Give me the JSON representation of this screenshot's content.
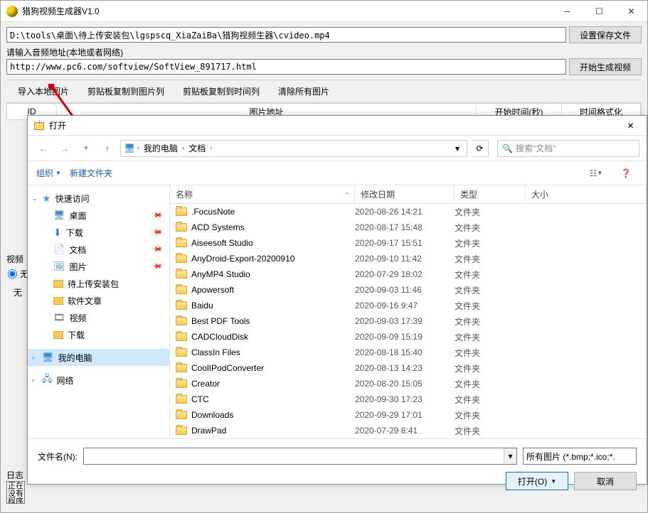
{
  "main": {
    "title": "猎狗视频生成器V1.0",
    "path_input": "D:\\tools\\桌面\\待上传安装包\\lgspscq_XiaZaiBa\\猎狗视频生器\\cvideo.mp4",
    "audio_label": "请输入音频地址(本地或者网络)",
    "audio_input": "http://www.pc6.com/softview/SoftView_891717.html",
    "btn_save": "设置保存文件",
    "btn_start": "开始生成视频",
    "toolbar": {
      "import": "导入本地图片",
      "copy_pic": "剪贴板复制到图片列",
      "copy_time": "剪贴板复制到时间列",
      "clear": "清除所有图片"
    },
    "grid": {
      "id": "ID",
      "addr": "图片地址",
      "start": "开始时间(秒)",
      "time": "时间格式化"
    },
    "side": {
      "video": "视频",
      "none_radio": "无",
      "none": "无"
    },
    "log": {
      "label": "日志",
      "text": "正在\n没有\n程序"
    }
  },
  "dialog": {
    "title": "打开",
    "breadcrumb": {
      "pc": "我的电脑",
      "docs": "文档"
    },
    "search_placeholder": "搜索\"文档\"",
    "organize": "组织",
    "newfolder": "新建文件夹",
    "headers": {
      "name": "名称",
      "date": "修改日期",
      "type": "类型",
      "size": "大小"
    },
    "tree": {
      "quick": "快速访问",
      "desktop": "桌面",
      "downloads": "下载",
      "documents": "文档",
      "pictures": "图片",
      "upload_pkg": "待上传安装包",
      "soft_article": "软件文章",
      "video": "视频",
      "downloads2": "下载",
      "this_pc": "我的电脑",
      "network": "网络"
    },
    "files": [
      {
        "name": ".FocusNote",
        "date": "2020-08-26 14:21",
        "type": "文件夹"
      },
      {
        "name": "ACD Systems",
        "date": "2020-08-17 15:48",
        "type": "文件夹"
      },
      {
        "name": "Aiseesoft Studio",
        "date": "2020-09-17 15:51",
        "type": "文件夹"
      },
      {
        "name": "AnyDroid-Export-20200910",
        "date": "2020-09-10 11:42",
        "type": "文件夹"
      },
      {
        "name": "AnyMP4 Studio",
        "date": "2020-07-29 18:02",
        "type": "文件夹"
      },
      {
        "name": "Apowersoft",
        "date": "2020-09-03 11:46",
        "type": "文件夹"
      },
      {
        "name": "Baidu",
        "date": "2020-09-16 9:47",
        "type": "文件夹"
      },
      {
        "name": "Best PDF Tools",
        "date": "2020-09-03 17:39",
        "type": "文件夹"
      },
      {
        "name": "CADCloudDisk",
        "date": "2020-09-09 15:19",
        "type": "文件夹"
      },
      {
        "name": "ClassIn Files",
        "date": "2020-08-18 15:40",
        "type": "文件夹"
      },
      {
        "name": "CoolIPodConverter",
        "date": "2020-08-13 14:23",
        "type": "文件夹"
      },
      {
        "name": "Creator",
        "date": "2020-08-20 15:05",
        "type": "文件夹"
      },
      {
        "name": "CTC",
        "date": "2020-09-30 17:23",
        "type": "文件夹"
      },
      {
        "name": "Downloads",
        "date": "2020-09-29 17:01",
        "type": "文件夹"
      },
      {
        "name": "DrawPad",
        "date": "2020-07-29 8:41",
        "type": "文件夹"
      }
    ],
    "filename_label": "文件名(N):",
    "filter": "所有图片 (*.bmp;*.ico;*.",
    "open_btn": "打开(O)",
    "cancel_btn": "取消"
  }
}
